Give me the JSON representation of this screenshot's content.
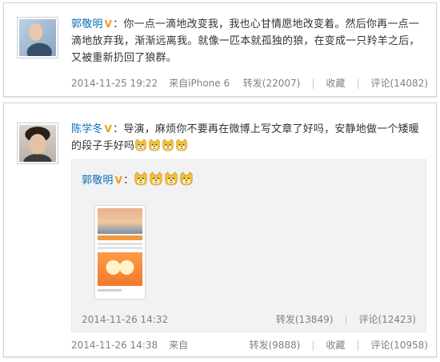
{
  "posts": [
    {
      "author": "郭敬明",
      "text": "你一点一滴地改变我，我也心甘情愿地改变着。然后你再一点一滴地放弃我，渐渐远离我。就像一匹本就孤独的狼，在变成一只羚羊之后，又被重新扔回了狼群。",
      "timestamp": "2014-11-25 19:22",
      "source": "来自iPhone 6",
      "repost_label": "转发(22007)",
      "favorite_label": "收藏",
      "comment_label": "评论(14082)"
    },
    {
      "author": "陈学冬",
      "text": "导演，麻烦你不要再在微博上写文章了好吗，安静地做一个矮暖的段子手好吗",
      "emoji_count": 4,
      "timestamp": "2014-11-26 14:38",
      "source": "来自",
      "repost_label": "转发(9888)",
      "favorite_label": "收藏",
      "comment_label": "评论(10958)",
      "reposted": {
        "author": "郭敬明",
        "emoji_count": 4,
        "timestamp": "2014-11-26 14:32",
        "repost_label": "转发(13849)",
        "comment_label": "评论(12423)"
      }
    }
  ],
  "badge": "V",
  "colon": "：",
  "colors": {
    "username": "#0a6fb8",
    "badge": "#f29a12",
    "meta": "#808080",
    "repost_bg": "#f2f2f5"
  },
  "icons": {
    "emoji": "doge-emoji-icon",
    "badge": "verified-v-icon"
  }
}
